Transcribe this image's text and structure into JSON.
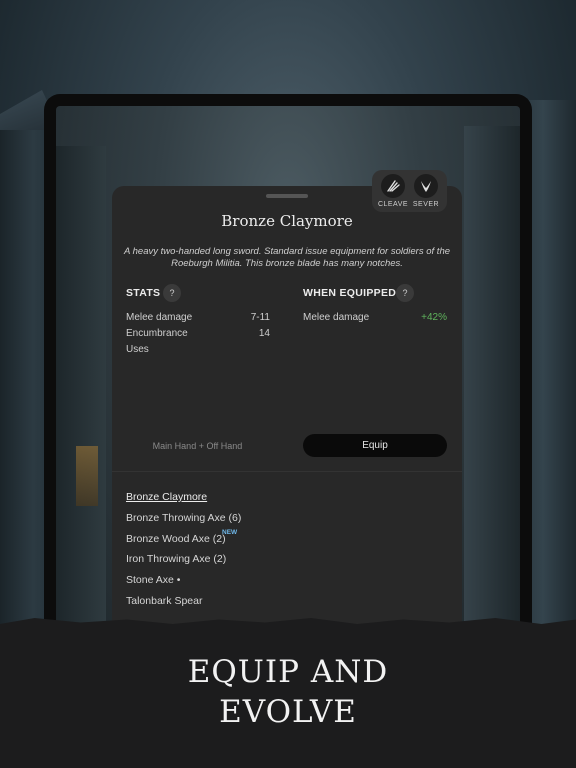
{
  "item": {
    "title": "Bronze Claymore",
    "description": "A heavy two-handed long sword. Standard issue equipment for soldiers of the Roeburgh Militia. This bronze blade has many notches."
  },
  "abilities": [
    {
      "label": "CLEAVE",
      "icon": "cleave-icon"
    },
    {
      "label": "SEVER",
      "icon": "sever-icon"
    }
  ],
  "stats": {
    "heading": "STATS",
    "help": "?",
    "rows": [
      {
        "label": "Melee damage",
        "value": "7-11"
      },
      {
        "label": "Encumbrance",
        "value": "14"
      },
      {
        "label": "Uses",
        "value": ""
      }
    ]
  },
  "when_equipped": {
    "heading": "WHEN EQUIPPED",
    "help": "?",
    "rows": [
      {
        "label": "Melee damage",
        "value": "+42%"
      }
    ]
  },
  "slot_label": "Main Hand + Off Hand",
  "equip_label": "Equip",
  "inventory": [
    {
      "label": "Bronze Claymore",
      "selected": true
    },
    {
      "label": "Bronze Throwing Axe (6)"
    },
    {
      "label": "Bronze Wood Axe (2)",
      "badge": "NEW"
    },
    {
      "label": "Iron Throwing Axe (2)"
    },
    {
      "label": "Stone Axe •"
    },
    {
      "label": "Talonbark Spear"
    }
  ],
  "tagline": {
    "line1": "EQUIP AND",
    "line2": "EVOLVE"
  },
  "colors": {
    "panel": "#282828",
    "bonus": "#5fb35c",
    "new_badge": "#6fb7e8"
  }
}
